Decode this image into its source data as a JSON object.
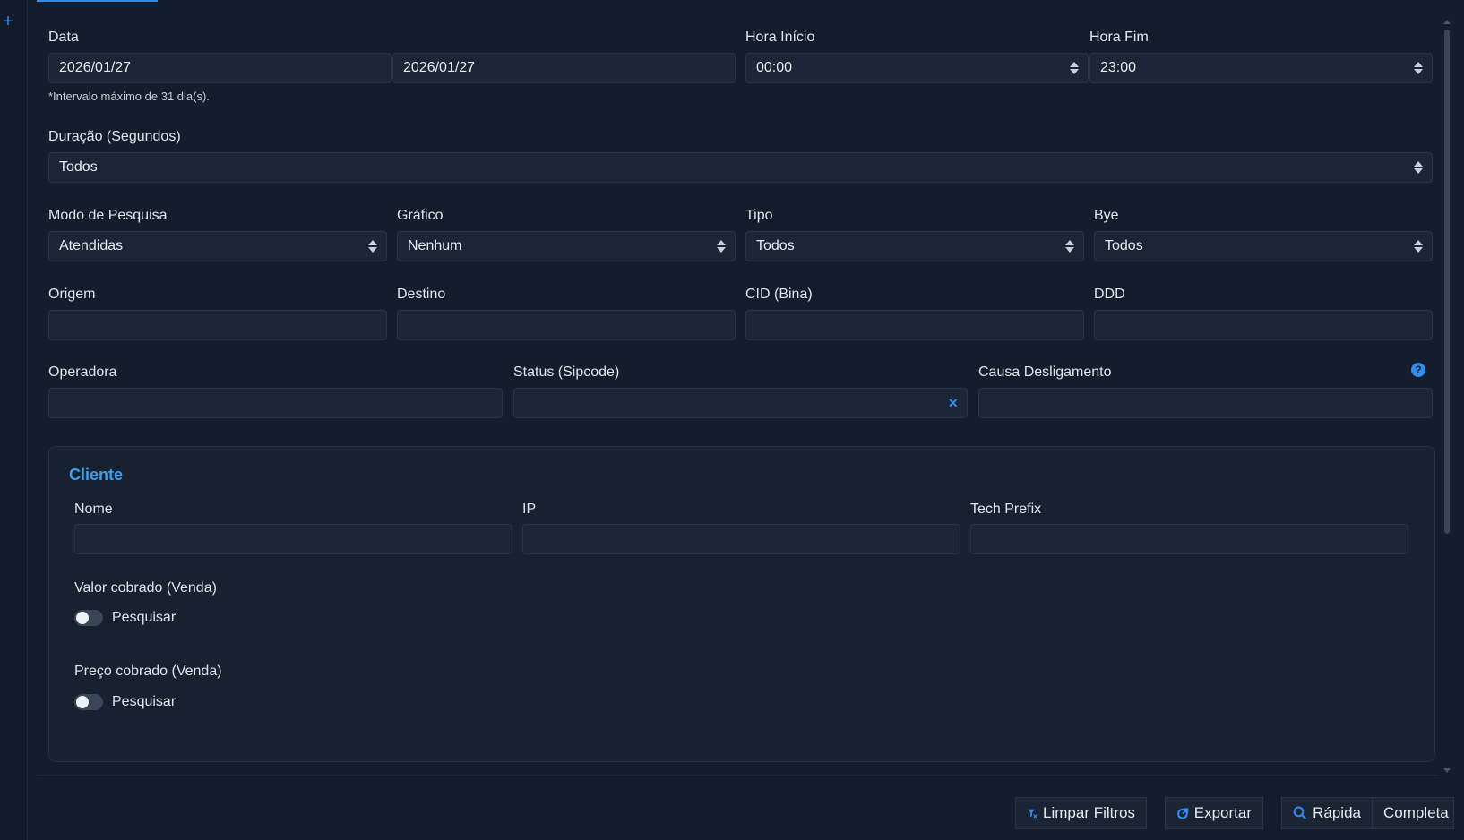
{
  "date": {
    "label": "Data",
    "start_value": "2026/01/27",
    "end_value": "2026/01/27",
    "hint": "*Intervalo máximo de 31 dia(s)."
  },
  "hora_inicio": {
    "label": "Hora Início",
    "value": "00:00"
  },
  "hora_fim": {
    "label": "Hora Fim",
    "value": "23:00"
  },
  "duracao": {
    "label": "Duração (Segundos)",
    "value": "Todos"
  },
  "modo_pesquisa": {
    "label": "Modo de Pesquisa",
    "value": "Atendidas"
  },
  "grafico": {
    "label": "Gráfico",
    "value": "Nenhum"
  },
  "tipo": {
    "label": "Tipo",
    "value": "Todos"
  },
  "bye": {
    "label": "Bye",
    "value": "Todos"
  },
  "origem": {
    "label": "Origem",
    "value": ""
  },
  "destino": {
    "label": "Destino",
    "value": ""
  },
  "cid": {
    "label": "CID (Bina)",
    "value": ""
  },
  "ddd": {
    "label": "DDD",
    "value": ""
  },
  "operadora": {
    "label": "Operadora",
    "value": ""
  },
  "status": {
    "label": "Status (Sipcode)",
    "value": "",
    "clear_glyph": "×"
  },
  "causa": {
    "label": "Causa Desligamento",
    "value": "",
    "help_glyph": "?"
  },
  "cliente": {
    "title": "Cliente",
    "nome": {
      "label": "Nome",
      "value": ""
    },
    "ip": {
      "label": "IP",
      "value": ""
    },
    "tech_prefix": {
      "label": "Tech Prefix",
      "value": ""
    },
    "valor": {
      "label": "Valor cobrado (Venda)",
      "toggle_label": "Pesquisar",
      "enabled": false
    },
    "preco": {
      "label": "Preço cobrado (Venda)",
      "toggle_label": "Pesquisar",
      "enabled": false
    }
  },
  "footer": {
    "limpar": "Limpar Filtros",
    "exportar": "Exportar",
    "rapida": "Rápida",
    "completa": "Completa"
  },
  "sidebar": {
    "plus_glyph": "+"
  },
  "colors": {
    "accent": "#2f8df0",
    "background": "#131d2c",
    "field": "#1b2535"
  }
}
